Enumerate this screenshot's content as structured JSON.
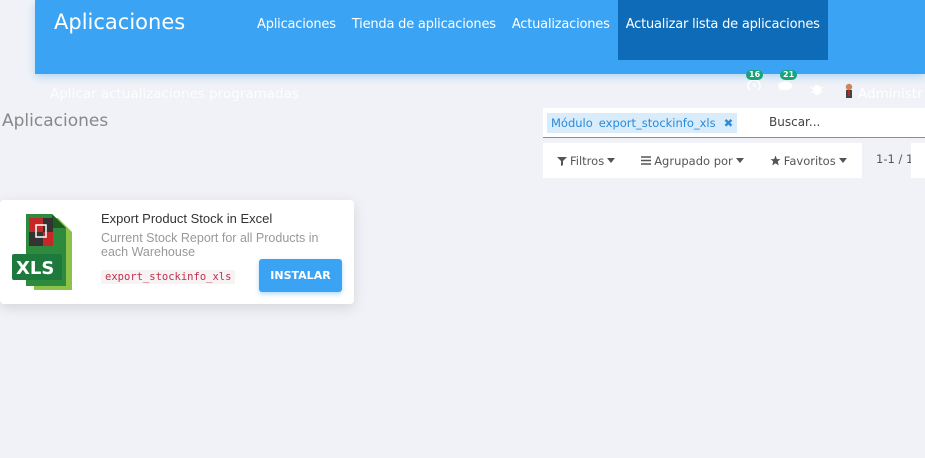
{
  "navbar": {
    "brand": "Aplicaciones",
    "menu": [
      "Aplicaciones",
      "Tienda de aplicaciones",
      "Actualizaciones",
      "Actualizar lista de aplicaciones"
    ],
    "active_menu_index": 3,
    "hidden_action": "Aplicar actualizaciones programadas",
    "systray": {
      "activity_count": "16",
      "messages_count": "21",
      "user_label": "Administr"
    }
  },
  "breadcrumb": "Aplicaciones",
  "search": {
    "facet_field": "Módulo",
    "facet_value": "export_stockinfo_xls",
    "facet_remove": "✖",
    "placeholder": "Buscar..."
  },
  "options": {
    "filters": "Filtros",
    "group_by": "Agrupado por",
    "favorites": "Favoritos"
  },
  "pager": "1-1 / 1",
  "module_card": {
    "logo_text": "XLS",
    "title": "Export Product Stock in Excel",
    "summary": "Current Stock Report for all Products in each Warehouse",
    "technical_name": "export_stockinfo_xls",
    "install_label": "INSTALAR"
  },
  "colors": {
    "primary": "#3aa3f3",
    "active_menu": "#0e6bb8",
    "background": "#f1f2f7",
    "badge": "#1aa37a",
    "logo_green": "#1e7a3c"
  }
}
